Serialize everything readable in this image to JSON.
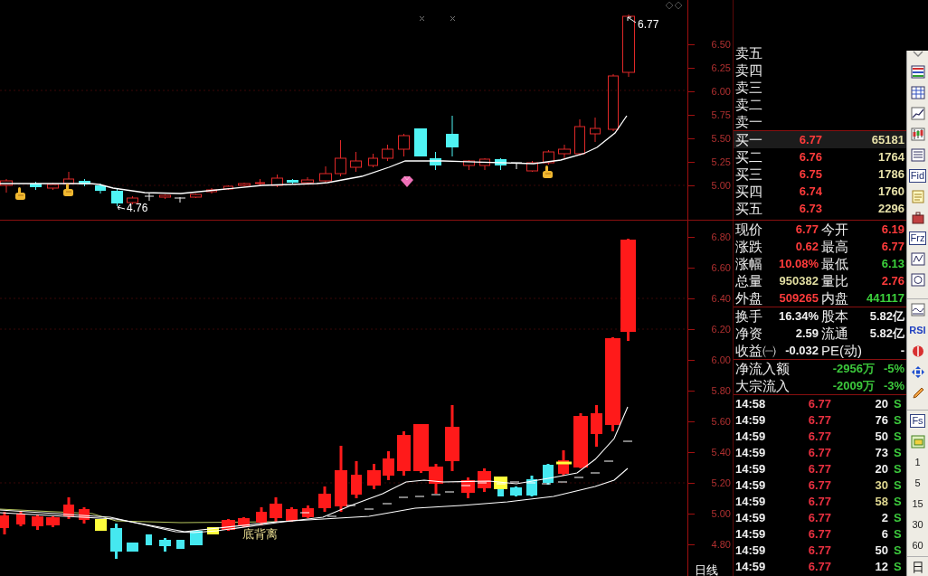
{
  "top_chart": {
    "axis_labels": [
      "6.50",
      "6.25",
      "6.00",
      "5.75",
      "5.50",
      "5.25",
      "5.00"
    ],
    "low_marker": {
      "text": "4.76"
    },
    "high_marker": {
      "text": "6.77"
    }
  },
  "bottom_chart": {
    "axis_labels": [
      "6.80",
      "6.60",
      "6.40",
      "6.20",
      "6.00",
      "5.80",
      "5.60",
      "5.40",
      "5.20",
      "5.00",
      "4.80"
    ],
    "signal_label": "底背离",
    "period_label": "日线"
  },
  "order_book": {
    "asks": [
      {
        "label": "卖五"
      },
      {
        "label": "卖四"
      },
      {
        "label": "卖三"
      },
      {
        "label": "卖二"
      },
      {
        "label": "卖一"
      }
    ],
    "bids": [
      {
        "label": "买一",
        "price": "6.77",
        "volume": "65181",
        "highlighted": true
      },
      {
        "label": "买二",
        "price": "6.76",
        "volume": "1764",
        "highlighted": false
      },
      {
        "label": "买三",
        "price": "6.75",
        "volume": "1786",
        "highlighted": false
      },
      {
        "label": "买四",
        "price": "6.74",
        "volume": "1760",
        "highlighted": false
      },
      {
        "label": "买五",
        "price": "6.73",
        "volume": "2296",
        "highlighted": false
      }
    ]
  },
  "quote": [
    {
      "label": "现价",
      "value": "6.77",
      "color": "#ff3b3b"
    },
    {
      "label": "今开",
      "value": "6.19",
      "color": "#ff3b3b"
    },
    {
      "label": "涨跌",
      "value": "0.62",
      "color": "#ff3b3b"
    },
    {
      "label": "最高",
      "value": "6.77",
      "color": "#ff3b3b"
    },
    {
      "label": "涨幅",
      "value": "10.08%",
      "color": "#ff3b3b"
    },
    {
      "label": "最低",
      "value": "6.13",
      "color": "#3cd23c"
    },
    {
      "label": "总量",
      "value": "950382",
      "color": "#e0dca0"
    },
    {
      "label": "量比",
      "value": "2.76",
      "color": "#ff3b3b"
    },
    {
      "label": "外盘",
      "value": "509265",
      "color": "#ff3b3b"
    },
    {
      "label": "内盘",
      "value": "441117",
      "color": "#3cd23c"
    }
  ],
  "fundamentals": [
    {
      "label": "换手",
      "value": "16.34%"
    },
    {
      "label": "股本",
      "value": "5.82亿"
    },
    {
      "label": "净资",
      "value": "2.59"
    },
    {
      "label": "流通",
      "value": "5.82亿"
    },
    {
      "label": "收益㈠",
      "value": "-0.032"
    },
    {
      "label": "PE(动)",
      "value": "-"
    }
  ],
  "fund_flows": [
    {
      "label": "净流入额",
      "amount": "-2956万",
      "percent": "-5%"
    },
    {
      "label": "大宗流入",
      "amount": "-2009万",
      "percent": "-3%"
    }
  ],
  "trades": [
    {
      "time": "14:58",
      "price": "6.77",
      "volume": "20",
      "side": "S",
      "color": "#f0f0f0"
    },
    {
      "time": "14:59",
      "price": "6.77",
      "volume": "76",
      "side": "S",
      "color": "#f0f0f0"
    },
    {
      "time": "14:59",
      "price": "6.77",
      "volume": "50",
      "side": "S",
      "color": "#f0f0f0"
    },
    {
      "time": "14:59",
      "price": "6.77",
      "volume": "73",
      "side": "S",
      "color": "#f0f0f0"
    },
    {
      "time": "14:59",
      "price": "6.77",
      "volume": "20",
      "side": "S",
      "color": "#f0f0f0"
    },
    {
      "time": "14:59",
      "price": "6.77",
      "volume": "30",
      "side": "S",
      "color": "#e0d890"
    },
    {
      "time": "14:59",
      "price": "6.77",
      "volume": "58",
      "side": "S",
      "color": "#e0d890"
    },
    {
      "time": "14:59",
      "price": "6.77",
      "volume": "2",
      "side": "S",
      "color": "#f0f0f0"
    },
    {
      "time": "14:59",
      "price": "6.77",
      "volume": "6",
      "side": "S",
      "color": "#f0f0f0"
    },
    {
      "time": "14:59",
      "price": "6.77",
      "volume": "50",
      "side": "S",
      "color": "#f0f0f0"
    },
    {
      "time": "14:59",
      "price": "6.77",
      "volume": "12",
      "side": "S",
      "color": "#f0f0f0"
    }
  ],
  "toolbar": {
    "text_buttons": [
      "Fid",
      "Frz",
      "RSI",
      "Fs"
    ],
    "periods": [
      "1",
      "5",
      "15",
      "30",
      "60",
      "日"
    ]
  }
}
